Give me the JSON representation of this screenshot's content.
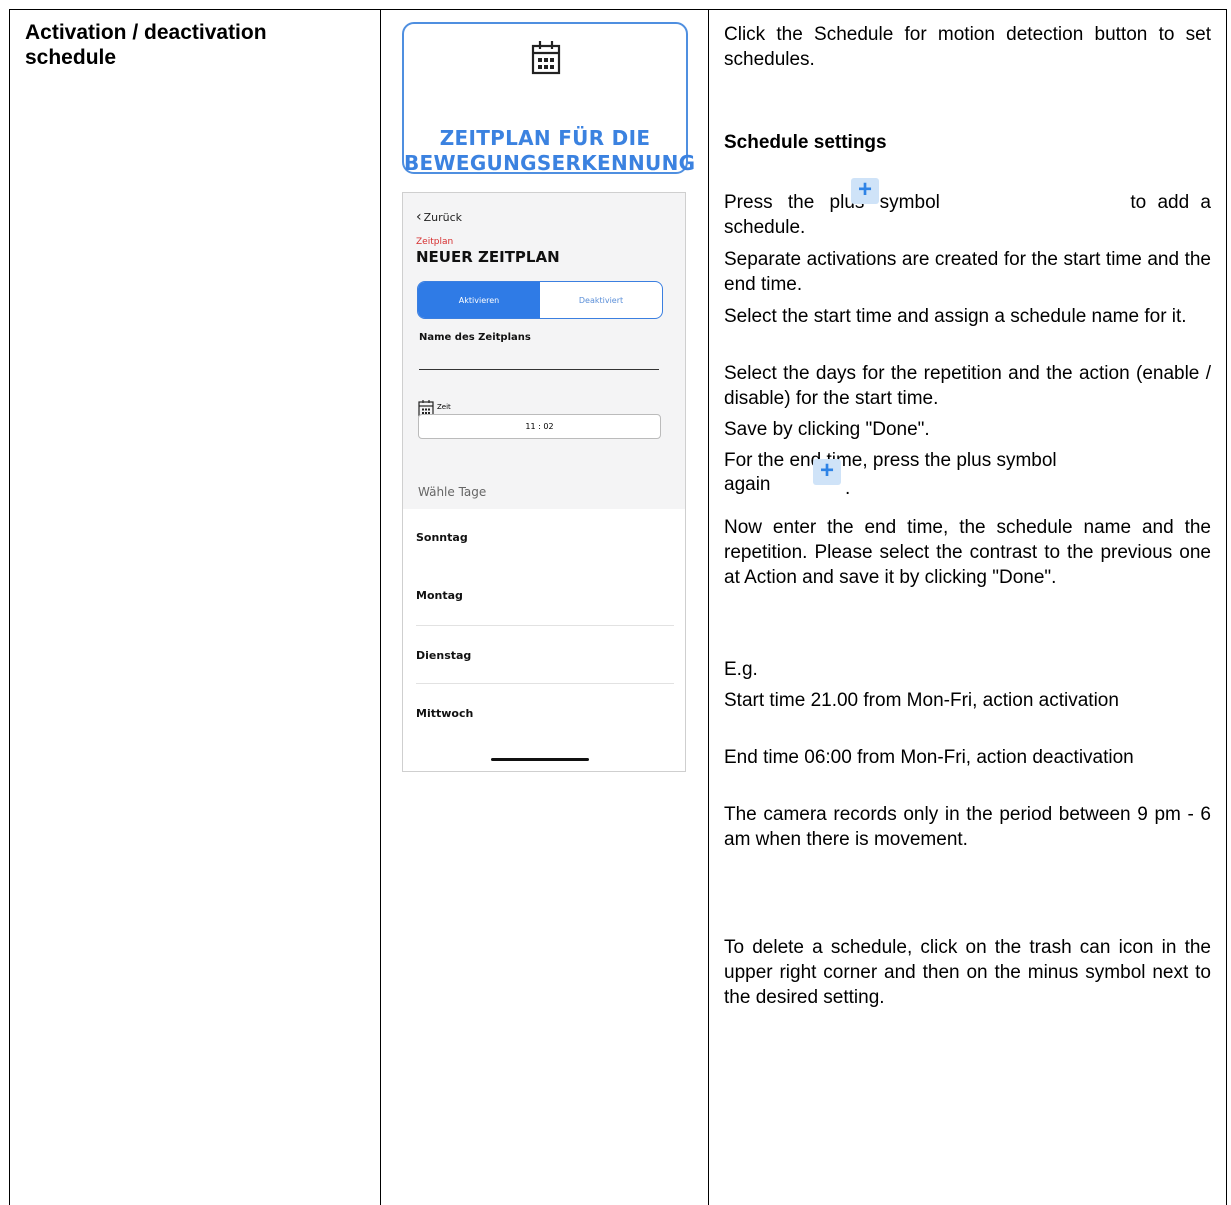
{
  "section_title": "Activation / deactivation schedule",
  "button_card": {
    "icon": "calendar-icon",
    "line1": "ZEITPLAN FÜR DIE",
    "line2": "BEWEGUNGSERKENNUNG"
  },
  "phone": {
    "back_label": "Zurück",
    "section_label": "Zeitplan",
    "title": "NEUER ZEITPLAN",
    "toggle": {
      "active": "Aktivieren",
      "inactive": "Deaktiviert"
    },
    "name_label": "Name des Zeitplans",
    "time_label": "Zeit",
    "time_value": "11 : 02",
    "days_label": "Wähle Tage",
    "days": [
      "Sonntag",
      "Montag",
      "Dienstag",
      "Mittwoch"
    ]
  },
  "instructions": {
    "intro": "Click the Schedule for motion detection button to set schedules.",
    "heading": "Schedule settings",
    "plus_before": "Press the plus symbol",
    "plus_after": "to add a schedule.",
    "p_separate": "Separate activations are created for the start time and the end time.",
    "p_select_start": "Select the start time and assign a schedule name for it.",
    "p_select_days": "Select the days for the repetition and the action (enable / disable) for the start time.",
    "p_save": "Save by clicking \"Done\".",
    "p_end_line1": "For the end time, press the plus symbol",
    "p_end_again": "again",
    "p_end_dot": ".",
    "p_enter": "Now enter the end time, the schedule name and the repetition. Please select the contrast to the previous one at Action and save it by clicking \"Done\".",
    "eg": "E.g.",
    "eg_start": "Start time 21.00 from Mon-Fri, action activation",
    "eg_end": "End time 06:00 from Mon-Fri, action deactivation",
    "eg_result": "The camera records only in the period between 9 pm - 6 am when there is movement.",
    "delete": "To delete a schedule, click on the trash can icon in the upper right corner and then on the minus symbol next to the desired setting.",
    "plus_icon": "plus-icon"
  }
}
